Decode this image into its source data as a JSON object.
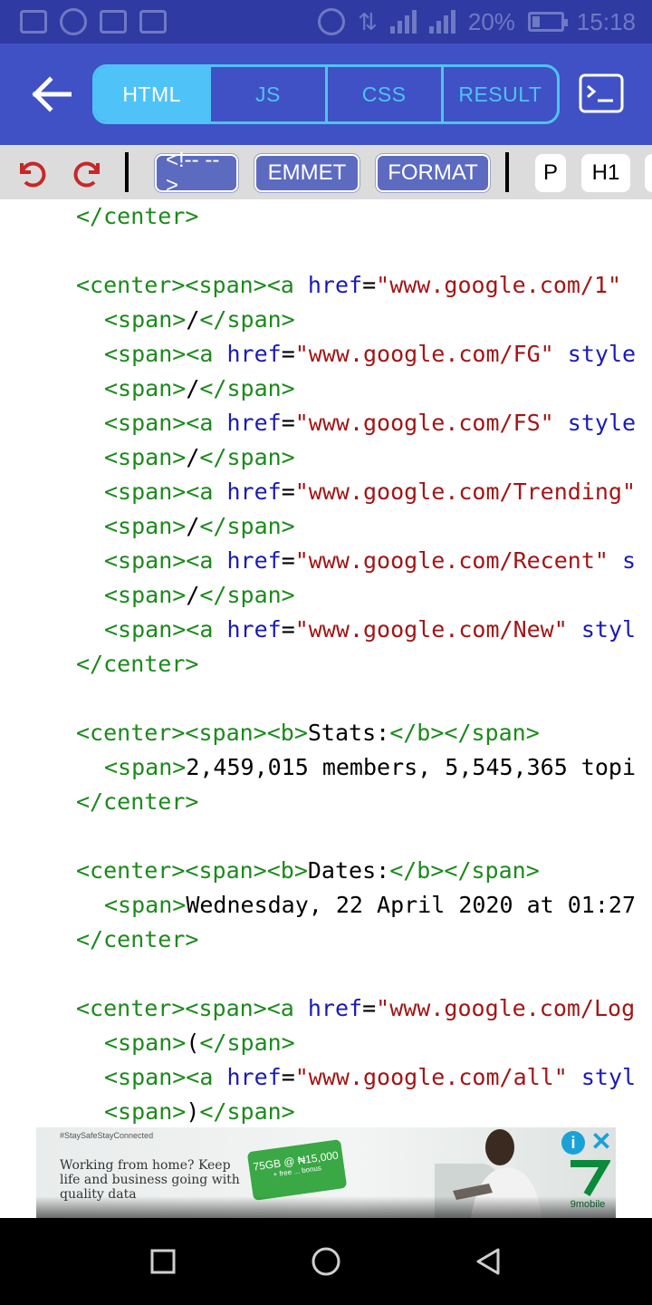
{
  "status_bar": {
    "battery_percent": "20%",
    "time": "15:18",
    "icons": [
      "gallery-icon",
      "whatsapp-icon",
      "activity-icon",
      "facebook-icon",
      "hotspot-icon",
      "data-transfer-icon",
      "signal-icon",
      "battery-icon"
    ]
  },
  "app_bar": {
    "tabs": [
      {
        "label": "HTML",
        "active": true
      },
      {
        "label": "JS",
        "active": false
      },
      {
        "label": "CSS",
        "active": false
      },
      {
        "label": "RESULT",
        "active": false
      }
    ],
    "accent_color": "#4fc3f7",
    "bar_color": "#3f51c4"
  },
  "toolbar": {
    "comment_label": "<!-- -->",
    "emmet_label": "EMMET",
    "format_label": "FORMAT",
    "p_label": "P",
    "h1_label": "H1"
  },
  "code": {
    "lines": [
      [
        [
          "t",
          "</center>"
        ]
      ],
      [],
      [
        [
          "t",
          "<center><span><a "
        ],
        [
          "a",
          "href"
        ],
        [
          "x",
          "="
        ],
        [
          "v",
          "\"www.google.com/1\""
        ]
      ],
      [
        [
          "t",
          "<span>"
        ],
        [
          "x",
          "/"
        ],
        [
          "t",
          "</span>"
        ]
      ],
      [
        [
          "t",
          "<span><a "
        ],
        [
          "a",
          "href"
        ],
        [
          "x",
          "="
        ],
        [
          "v",
          "\"www.google.com/FG\""
        ],
        [
          "x",
          " "
        ],
        [
          "a",
          "style"
        ]
      ],
      [
        [
          "t",
          "<span>"
        ],
        [
          "x",
          "/"
        ],
        [
          "t",
          "</span>"
        ]
      ],
      [
        [
          "t",
          "<span><a "
        ],
        [
          "a",
          "href"
        ],
        [
          "x",
          "="
        ],
        [
          "v",
          "\"www.google.com/FS\""
        ],
        [
          "x",
          " "
        ],
        [
          "a",
          "style"
        ]
      ],
      [
        [
          "t",
          "<span>"
        ],
        [
          "x",
          "/"
        ],
        [
          "t",
          "</span>"
        ]
      ],
      [
        [
          "t",
          "<span><a "
        ],
        [
          "a",
          "href"
        ],
        [
          "x",
          "="
        ],
        [
          "v",
          "\"www.google.com/Trending\""
        ]
      ],
      [
        [
          "t",
          "<span>"
        ],
        [
          "x",
          "/"
        ],
        [
          "t",
          "</span>"
        ]
      ],
      [
        [
          "t",
          "<span><a "
        ],
        [
          "a",
          "href"
        ],
        [
          "x",
          "="
        ],
        [
          "v",
          "\"www.google.com/Recent\""
        ],
        [
          "x",
          " "
        ],
        [
          "a",
          "s"
        ]
      ],
      [
        [
          "t",
          "<span>"
        ],
        [
          "x",
          "/"
        ],
        [
          "t",
          "</span>"
        ]
      ],
      [
        [
          "t",
          "<span><a "
        ],
        [
          "a",
          "href"
        ],
        [
          "x",
          "="
        ],
        [
          "v",
          "\"www.google.com/New\""
        ],
        [
          "x",
          " "
        ],
        [
          "a",
          "styl"
        ]
      ],
      [
        [
          "t",
          "</center>"
        ]
      ],
      [],
      [
        [
          "t",
          "<center><span><b>"
        ],
        [
          "x",
          "Stats:"
        ],
        [
          "t",
          "</b></span>"
        ]
      ],
      [
        [
          "t",
          "<span>"
        ],
        [
          "x",
          "2,459,015 members, 5,545,365 topi"
        ]
      ],
      [
        [
          "t",
          "</center>"
        ]
      ],
      [],
      [
        [
          "t",
          "<center><span><b>"
        ],
        [
          "x",
          "Dates:"
        ],
        [
          "t",
          "</b></span>"
        ]
      ],
      [
        [
          "t",
          "<span>"
        ],
        [
          "x",
          "Wednesday, 22 April 2020 at 01:27"
        ]
      ],
      [
        [
          "t",
          "</center>"
        ]
      ],
      [],
      [
        [
          "t",
          "<center><span><a "
        ],
        [
          "a",
          "href"
        ],
        [
          "x",
          "="
        ],
        [
          "v",
          "\"www.google.com/Log"
        ]
      ],
      [
        [
          "t",
          "<span>"
        ],
        [
          "x",
          "("
        ],
        [
          "t",
          "</span>"
        ]
      ],
      [
        [
          "t",
          "<span><a "
        ],
        [
          "a",
          "href"
        ],
        [
          "x",
          "="
        ],
        [
          "v",
          "\"www.google.com/all\""
        ],
        [
          "x",
          " "
        ],
        [
          "a",
          "styl"
        ]
      ],
      [
        [
          "t",
          "<span>"
        ],
        [
          "x",
          ")"
        ],
        [
          "t",
          "</span>"
        ]
      ]
    ],
    "indent_levels": [
      0,
      0,
      0,
      1,
      1,
      1,
      1,
      1,
      1,
      1,
      1,
      1,
      1,
      0,
      0,
      0,
      1,
      0,
      0,
      0,
      1,
      0,
      0,
      0,
      1,
      1,
      1
    ],
    "colors": {
      "tag": "#1b8a1b",
      "attr": "#1a1ab8",
      "value": "#a31515",
      "text": "#000000"
    }
  },
  "ad": {
    "small_text": "#StaySafeStayConnected",
    "headline": "Working from home? Keep life and business going with quality data",
    "badge_text": "75GB @ ₦15,000",
    "badge_subtext": "+ free ... bonus",
    "brand": "9mobile",
    "info_icon": "info-icon",
    "close_icon": "close-icon"
  },
  "nav_bar": {
    "icons": [
      "recents-square-icon",
      "home-circle-icon",
      "back-triangle-icon"
    ]
  }
}
